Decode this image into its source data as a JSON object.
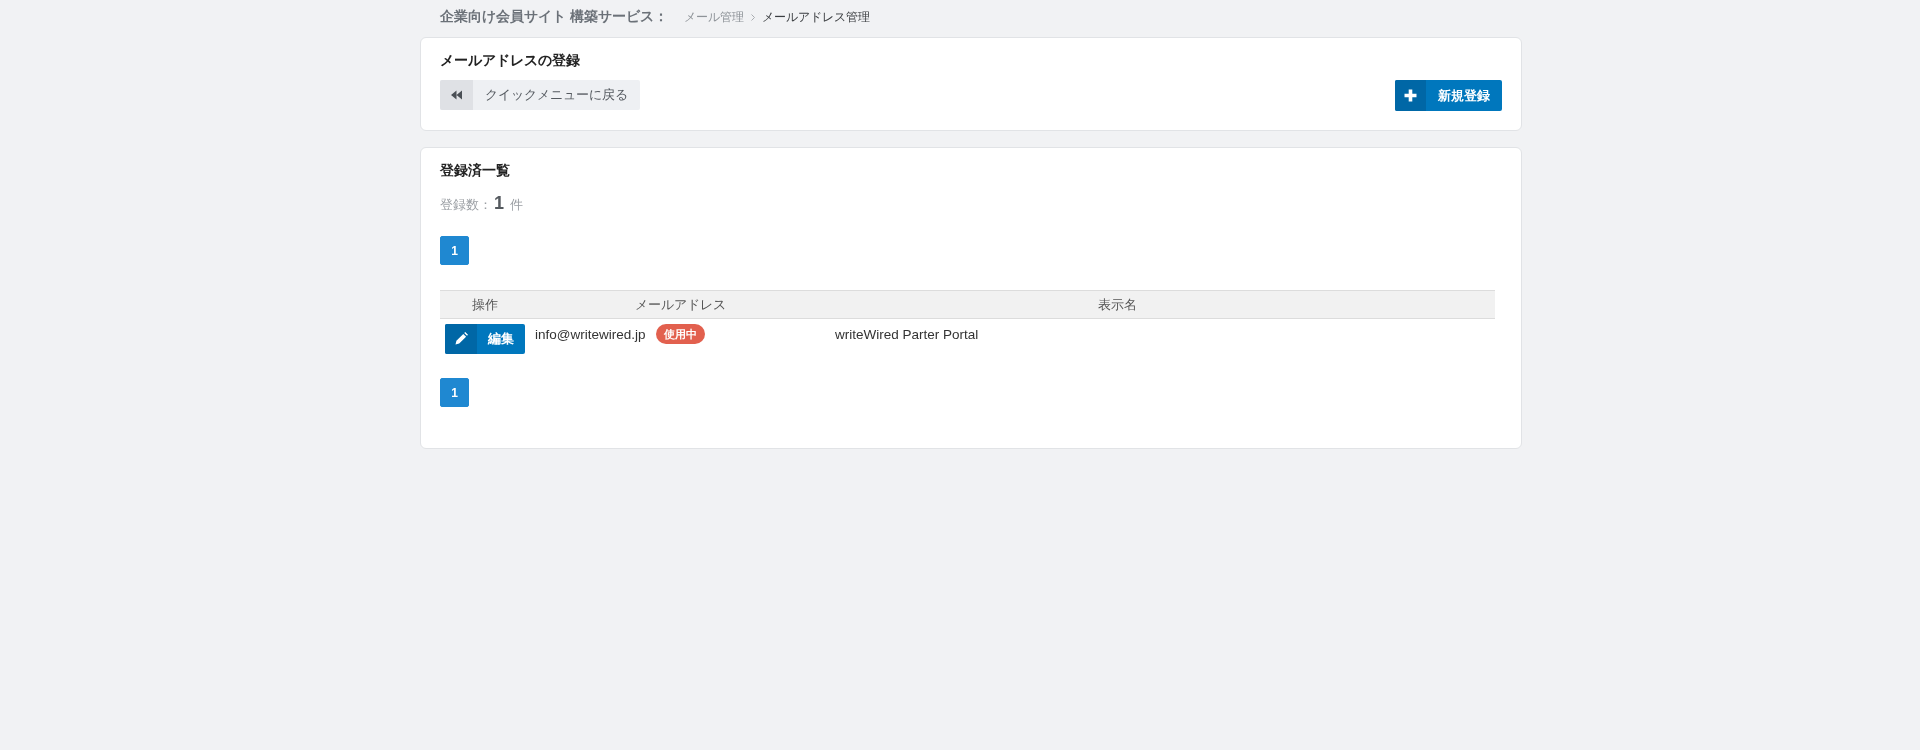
{
  "header": {
    "site_title": "企業向け会員サイト 構築サービス：",
    "breadcrumb": [
      {
        "label": "メール管理",
        "current": false
      },
      {
        "label": "メールアドレス管理",
        "current": true
      }
    ]
  },
  "register_panel": {
    "title": "メールアドレスの登録",
    "back_button": "クイックメニューに戻る",
    "new_button": "新規登録"
  },
  "list_panel": {
    "title": "登録済一覧",
    "count_label": "登録数：",
    "count": "1",
    "count_unit": "件",
    "pagination_top": [
      {
        "label": "1",
        "selected": true
      }
    ],
    "table": {
      "columns": [
        "操作",
        "メールアドレス",
        "表示名"
      ],
      "rows": [
        {
          "action": "編集",
          "email": "info@writewired.jp",
          "status": "使用中",
          "display_name": "writeWired Parter Portal"
        }
      ]
    },
    "pagination_bottom": [
      {
        "label": "1",
        "selected": true
      }
    ]
  }
}
